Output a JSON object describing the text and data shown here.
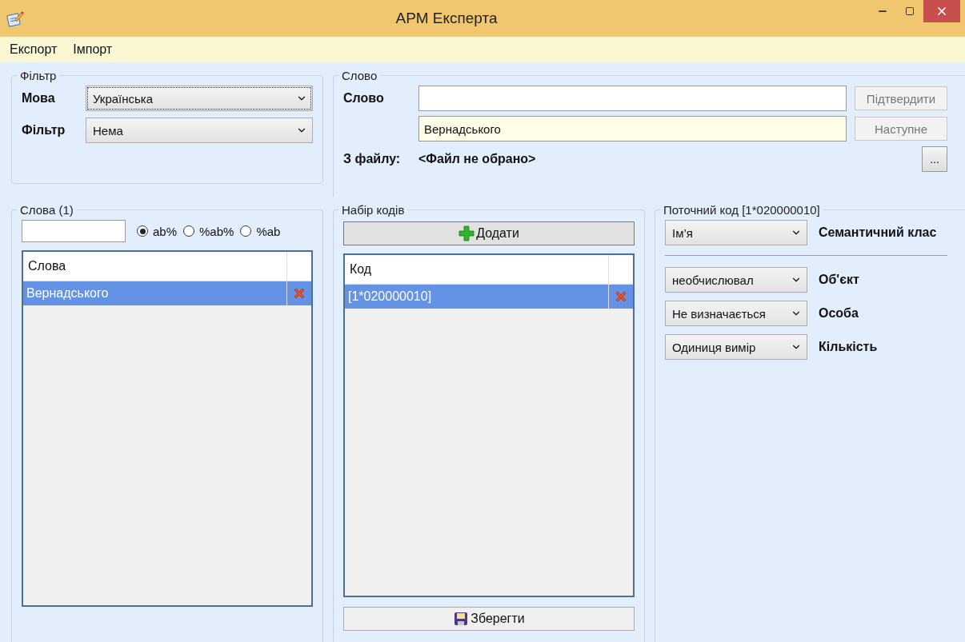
{
  "window": {
    "title": "АРМ Експерта"
  },
  "menu": [
    "Експорт",
    "Імпорт"
  ],
  "filter": {
    "legend": "Фільтр",
    "fields": [
      {
        "label": "Мова",
        "value": "Українська",
        "focused": true
      },
      {
        "label": "Фільтр",
        "value": "Нема",
        "focused": false
      }
    ]
  },
  "word": {
    "legend": "Слово",
    "label": "Слово",
    "suggestion": "Вернадського",
    "buttons": [
      {
        "label": "Підтвердити",
        "disabled": true
      },
      {
        "label": "Наступне",
        "disabled": true
      }
    ],
    "file_label": "З файлу:",
    "file_value": "<Файл не обрано>",
    "browse": "..."
  },
  "words": {
    "legend": "Слова (1)",
    "radios": [
      {
        "label": "ab%",
        "selected": true
      },
      {
        "label": "%ab%",
        "selected": false
      },
      {
        "label": "%ab",
        "selected": false
      }
    ],
    "column": "Слова",
    "rows": [
      {
        "text": "Вернадського",
        "selected": true
      }
    ]
  },
  "codes": {
    "legend": "Набір кодів",
    "add": "Додати",
    "column": "Код",
    "rows": [
      {
        "text": "[1*020000010]",
        "selected": true
      }
    ],
    "save": "Зберегти"
  },
  "current": {
    "legend": "Поточний код [1*020000010]",
    "fields": [
      {
        "value": "Ім’я",
        "label": "Семантичний клас"
      },
      {
        "value": "необчислювал",
        "label": "Об'єкт"
      },
      {
        "value": "Не визначається",
        "label": "Особа"
      },
      {
        "value": "Одиниця вимір",
        "label": "Кількість"
      }
    ]
  }
}
